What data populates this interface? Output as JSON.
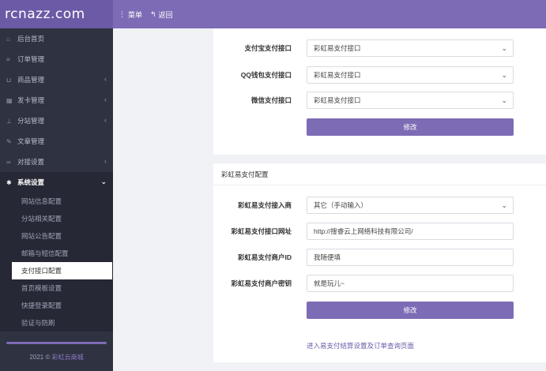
{
  "brand": "rcnazz.com",
  "topnav": {
    "menu_label": "菜单",
    "back_label": "返回"
  },
  "sidebar": {
    "items": [
      {
        "label": "后台首页",
        "icon": "home-icon",
        "glyph": "⌂",
        "caret": false
      },
      {
        "label": "订单管理",
        "icon": "list-icon",
        "glyph": "≡",
        "caret": false
      },
      {
        "label": "商品管理",
        "icon": "cart-icon",
        "glyph": "⊔",
        "caret": true
      },
      {
        "label": "发卡管理",
        "icon": "grid-icon",
        "glyph": "▦",
        "caret": true
      },
      {
        "label": "分站管理",
        "icon": "sitemap-icon",
        "glyph": "⊥",
        "caret": true
      },
      {
        "label": "文章管理",
        "icon": "edit-icon",
        "glyph": "✎",
        "caret": false
      },
      {
        "label": "对接设置",
        "icon": "link-icon",
        "glyph": "∞",
        "caret": true
      }
    ],
    "open_item": {
      "label": "系统设置",
      "icon": "gear-icon",
      "glyph": "✱"
    },
    "sub_items": [
      {
        "label": "网站信息配置",
        "active": false
      },
      {
        "label": "分站相关配置",
        "active": false
      },
      {
        "label": "网站公告配置",
        "active": false
      },
      {
        "label": "邮箱与短信配置",
        "active": false
      },
      {
        "label": "支付接口配置",
        "active": true
      },
      {
        "label": "首页模板设置",
        "active": false
      },
      {
        "label": "快捷登录配置",
        "active": false
      },
      {
        "label": "验证与防刷",
        "active": false
      }
    ],
    "footer_year": "2021 ©",
    "footer_link": "彩虹云商城"
  },
  "panel1": {
    "rows": [
      {
        "label": "支付宝支付接口",
        "value": "彩虹易支付接口"
      },
      {
        "label": "QQ钱包支付接口",
        "value": "彩虹易支付接口"
      },
      {
        "label": "微信支付接口",
        "value": "彩虹易支付接口"
      }
    ],
    "submit_label": "修改"
  },
  "panel2": {
    "title": "彩虹易支付配置",
    "provider_label": "彩虹易支付接入商",
    "provider_value": "其它（手动输入）",
    "url_label": "彩虹易支付接口网址",
    "url_value": "http://搜睿云上网络科技有限公司/",
    "merchant_id_label": "彩虹易支付商户ID",
    "merchant_id_value": "我随便填",
    "merchant_key_label": "彩虹易支付商户密钥",
    "merchant_key_value": "就是玩儿~",
    "submit_label": "修改",
    "footer_link": "进入易支付结算设置及订单查询页面"
  },
  "colors": {
    "accent": "#7e6bb5",
    "sidebar": "#2f3241",
    "background": "#f1f2f6"
  }
}
